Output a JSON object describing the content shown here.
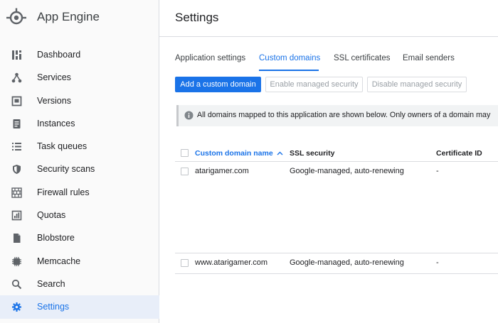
{
  "app": {
    "title": "App Engine"
  },
  "sidebar": {
    "items": [
      {
        "label": "Dashboard",
        "icon": "dashboard-icon"
      },
      {
        "label": "Services",
        "icon": "services-icon"
      },
      {
        "label": "Versions",
        "icon": "versions-icon"
      },
      {
        "label": "Instances",
        "icon": "instances-icon"
      },
      {
        "label": "Task queues",
        "icon": "task-queues-icon"
      },
      {
        "label": "Security scans",
        "icon": "shield-icon"
      },
      {
        "label": "Firewall rules",
        "icon": "firewall-icon"
      },
      {
        "label": "Quotas",
        "icon": "quotas-icon"
      },
      {
        "label": "Blobstore",
        "icon": "blobstore-icon"
      },
      {
        "label": "Memcache",
        "icon": "memcache-icon"
      },
      {
        "label": "Search",
        "icon": "search-icon"
      },
      {
        "label": "Settings",
        "icon": "gear-icon",
        "active": true
      }
    ]
  },
  "header": {
    "title": "Settings"
  },
  "tabs": [
    {
      "label": "Application settings"
    },
    {
      "label": "Custom domains",
      "active": true
    },
    {
      "label": "SSL certificates"
    },
    {
      "label": "Email senders"
    }
  ],
  "toolbar": {
    "add_label": "Add a custom domain",
    "enable_label": "Enable managed security",
    "disable_label": "Disable managed security"
  },
  "banner": {
    "text": "All domains mapped to this application are shown below. Only owners of a domain may"
  },
  "table": {
    "headers": {
      "domain": "Custom domain name",
      "ssl": "SSL security",
      "cert": "Certificate ID"
    },
    "rows": [
      {
        "domain": "atarigamer.com",
        "ssl": "Google-managed, auto-renewing",
        "cert": "-"
      },
      {
        "domain": "www.atarigamer.com",
        "ssl": "Google-managed, auto-renewing",
        "cert": "-"
      }
    ]
  },
  "colors": {
    "accent": "#1a73e8",
    "active_bg": "#e8eef9",
    "icon": "#5f6368"
  }
}
